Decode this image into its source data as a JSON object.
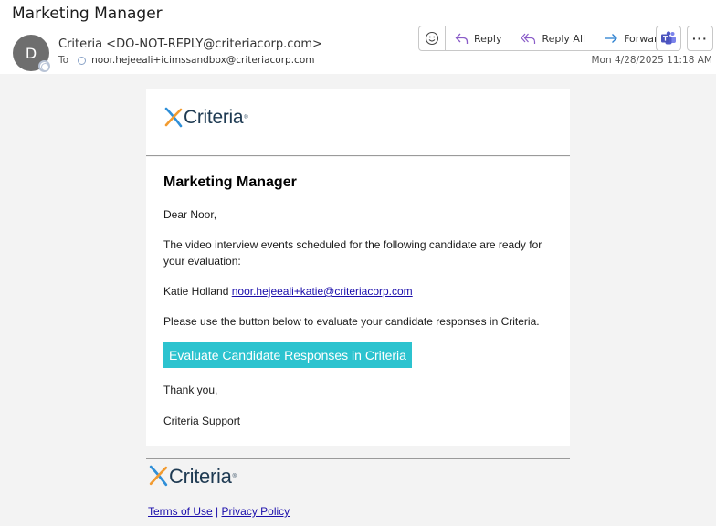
{
  "email": {
    "subject": "Marketing Manager",
    "avatar_initial": "D",
    "sender": "Criteria <DO-NOT-REPLY@criteriacorp.com>",
    "to_label": "To",
    "recipient": "noor.hejeeali+icimssandbox@criteriacorp.com",
    "date": "Mon 4/28/2025 11:18 AM"
  },
  "toolbar": {
    "reply_label": "Reply",
    "reply_all_label": "Reply All",
    "forward_label": "Forward",
    "more_label": "···"
  },
  "body": {
    "logo_text": "Criteria",
    "logo_mark": "®",
    "title": "Marketing Manager",
    "greeting": "Dear Noor,",
    "intro": "The video interview events scheduled for the following candidate are ready for your evaluation:",
    "candidate_name": "Katie Holland",
    "candidate_email": "noor.hejeeali+katie@criteriacorp.com",
    "instruction": "Please use the button below to evaluate your candidate responses in Criteria.",
    "cta_label": "Evaluate Candidate Responses in Criteria",
    "closing": "Thank you,",
    "signature": "Criteria Support"
  },
  "footer": {
    "logo_text": "Criteria",
    "logo_mark": "®",
    "terms_label": "Terms of Use",
    "separator": "|",
    "privacy_label": "Privacy Policy"
  },
  "colors": {
    "accent_teal": "#2cc3cf",
    "logo_orange": "#f29b30",
    "logo_blue": "#2f8fd8",
    "link": "#1a0dab"
  }
}
